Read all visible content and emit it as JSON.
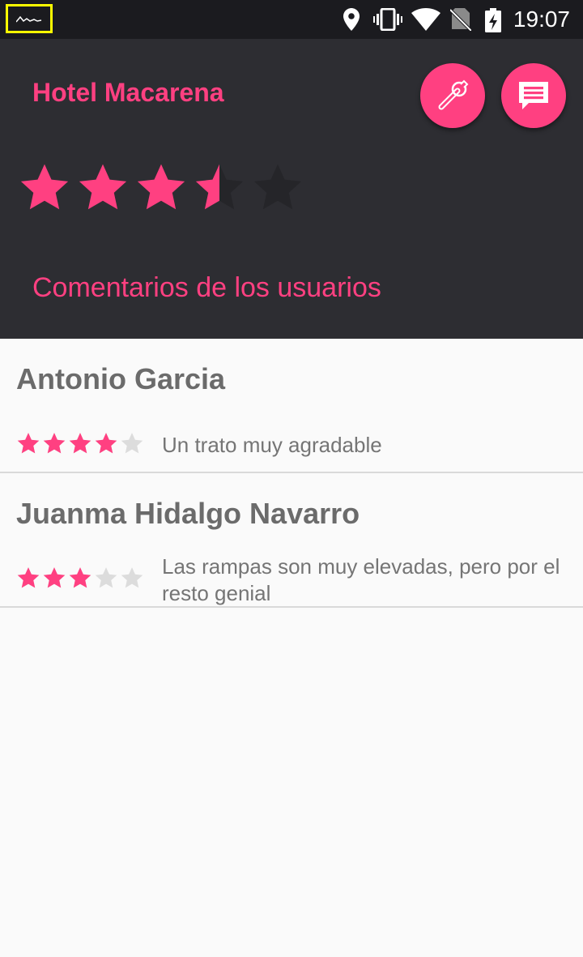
{
  "status_bar": {
    "time": "19:07",
    "icons": [
      "notification-icon",
      "location-icon",
      "vibrate-icon",
      "wifi-icon",
      "no-sim-icon",
      "battery-charging-icon"
    ]
  },
  "hotel": {
    "name": "Hotel Macarena",
    "rating": 3.5,
    "rating_max": 5
  },
  "actions": {
    "tools_icon": "wrench-icon",
    "comment_icon": "comment-icon"
  },
  "comments_section": {
    "title": "Comentarios de los usuarios"
  },
  "comments": [
    {
      "author": "Antonio Garcia",
      "rating": 4,
      "text": "Un trato muy agradable"
    },
    {
      "author": "Juanma Hidalgo Navarro",
      "rating": 3,
      "text": "Las rampas son muy elevadas, pero por el resto genial"
    }
  ],
  "colors": {
    "accent": "#ff4081",
    "header_bg": "#2d2d32",
    "status_bar_bg": "#1b1b1f",
    "star_empty_dark": "#252529",
    "star_empty_light": "#dcdcdc",
    "list_bg": "#fafafa"
  }
}
